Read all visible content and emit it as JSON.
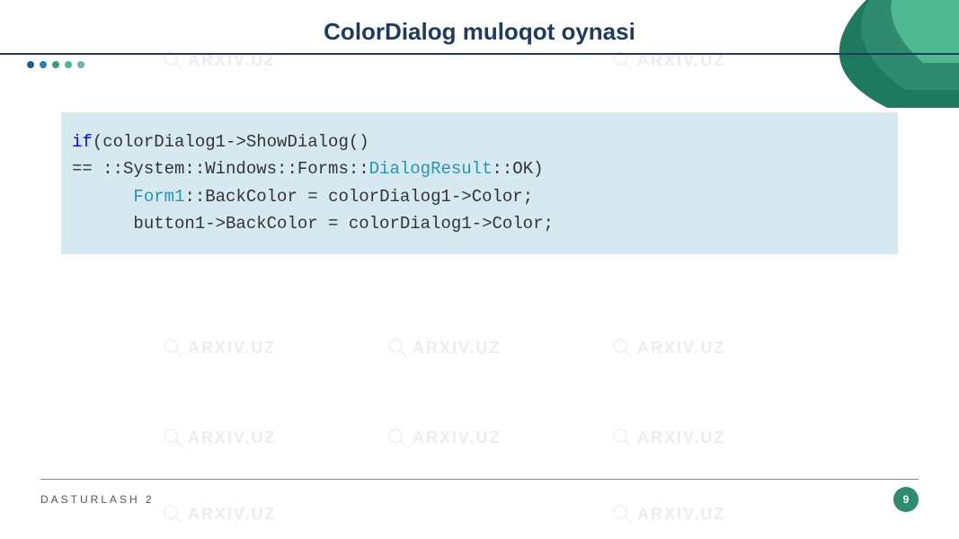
{
  "title": "ColorDialog muloqot oynasi",
  "code": {
    "line1_kw": "if",
    "line1_rest": "(colorDialog1->ShowDialog() ",
    "line2_pre": "== ::System::Windows::Forms::",
    "line2_type": "DialogResult",
    "line2_post": "::OK)",
    "line3_pre": "      ",
    "line3_type": "Form1",
    "line3_post": "::BackColor = colorDialog1->Color;",
    "line4": "      button1->BackColor = colorDialog1->Color;"
  },
  "footer": {
    "text": "DASTURLASH 2",
    "page": "9"
  },
  "watermark_text": "ARXIV.UZ",
  "dots": [
    {
      "color": "#1e5f8e"
    },
    {
      "color": "#2e7cb0"
    },
    {
      "color": "#3a9d7a"
    },
    {
      "color": "#4db892"
    },
    {
      "color": "#7aaeb0"
    }
  ]
}
